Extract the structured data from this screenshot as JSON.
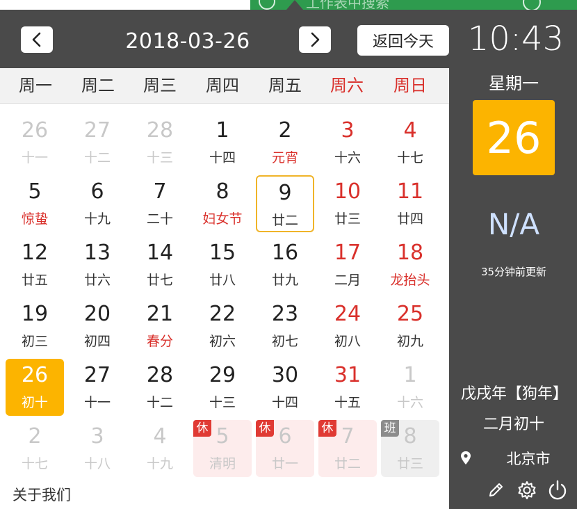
{
  "header": {
    "date": "2018-03-26",
    "today_label": "返回今天",
    "clock": "10:43"
  },
  "weekdays": [
    "周一",
    "周二",
    "周三",
    "周四",
    "周五",
    "周六",
    "周日"
  ],
  "weeks": [
    [
      {
        "n": "26",
        "s": "十一",
        "other": true
      },
      {
        "n": "27",
        "s": "十二",
        "other": true
      },
      {
        "n": "28",
        "s": "十三",
        "other": true
      },
      {
        "n": "1",
        "s": "十四"
      },
      {
        "n": "2",
        "s": "元宵",
        "festival": true
      },
      {
        "n": "3",
        "s": "十六",
        "weekend": true
      },
      {
        "n": "4",
        "s": "十七",
        "weekend": true
      }
    ],
    [
      {
        "n": "5",
        "s": "惊蛰",
        "festival": true
      },
      {
        "n": "6",
        "s": "十九"
      },
      {
        "n": "7",
        "s": "二十"
      },
      {
        "n": "8",
        "s": "妇女节",
        "festival": true
      },
      {
        "n": "9",
        "s": "廿二",
        "selected": true
      },
      {
        "n": "10",
        "s": "廿三",
        "weekend": true
      },
      {
        "n": "11",
        "s": "廿四",
        "weekend": true
      }
    ],
    [
      {
        "n": "12",
        "s": "廿五"
      },
      {
        "n": "13",
        "s": "廿六"
      },
      {
        "n": "14",
        "s": "廿七"
      },
      {
        "n": "15",
        "s": "廿八"
      },
      {
        "n": "16",
        "s": "廿九"
      },
      {
        "n": "17",
        "s": "二月",
        "weekend": true
      },
      {
        "n": "18",
        "s": "龙抬头",
        "weekend": true,
        "festival": true
      }
    ],
    [
      {
        "n": "19",
        "s": "初三"
      },
      {
        "n": "20",
        "s": "初四"
      },
      {
        "n": "21",
        "s": "春分",
        "festival": true
      },
      {
        "n": "22",
        "s": "初六"
      },
      {
        "n": "23",
        "s": "初七"
      },
      {
        "n": "24",
        "s": "初八",
        "weekend": true
      },
      {
        "n": "25",
        "s": "初九",
        "weekend": true
      }
    ],
    [
      {
        "n": "26",
        "s": "初十",
        "today": true
      },
      {
        "n": "27",
        "s": "十一"
      },
      {
        "n": "28",
        "s": "十二"
      },
      {
        "n": "29",
        "s": "十三"
      },
      {
        "n": "30",
        "s": "十四"
      },
      {
        "n": "31",
        "s": "十五",
        "weekend": true
      },
      {
        "n": "1",
        "s": "十六",
        "other": true
      }
    ],
    [
      {
        "n": "2",
        "s": "十七",
        "other": true
      },
      {
        "n": "3",
        "s": "十八",
        "other": true
      },
      {
        "n": "4",
        "s": "十九",
        "other": true
      },
      {
        "n": "5",
        "s": "清明",
        "other": true,
        "tag": "休",
        "tagType": "rest"
      },
      {
        "n": "6",
        "s": "廿一",
        "other": true,
        "tag": "休",
        "tagType": "rest"
      },
      {
        "n": "7",
        "s": "廿二",
        "other": true,
        "tag": "休",
        "tagType": "rest"
      },
      {
        "n": "8",
        "s": "廿三",
        "other": true,
        "tag": "班",
        "tagType": "work"
      }
    ]
  ],
  "footer": {
    "about": "关于我们"
  },
  "side": {
    "weekday": "星期一",
    "day": "26",
    "weather": "N/A",
    "update": "35分钟前更新",
    "lunar_year": "戊戌年【狗年】",
    "lunar_date": "二月初十",
    "city": "北京市"
  },
  "background_window": {
    "text": "工作表中搜索"
  },
  "icons": [
    "chevron-left-icon",
    "chevron-right-icon",
    "location-icon",
    "edit-icon",
    "settings-icon",
    "power-icon"
  ],
  "colors": {
    "accent": "#fcb400",
    "weekend": "#d9302b",
    "panel": "#4a4a4a"
  }
}
